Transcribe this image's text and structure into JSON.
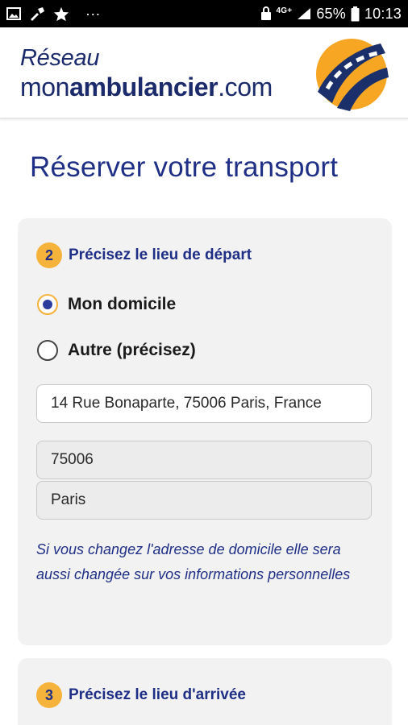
{
  "status_bar": {
    "left_icons": [
      "image-icon",
      "wrench-icon",
      "star-icon",
      "more-icon"
    ],
    "more_text": "···",
    "network": "4G+",
    "battery_percent": "65%",
    "time": "10:13"
  },
  "header": {
    "brand_line1": "Réseau",
    "brand_prefix": "mon",
    "brand_bold": "ambulancier",
    "brand_suffix": ".com",
    "logo_colors": {
      "blue": "#1b2f6b",
      "orange": "#f6a623"
    }
  },
  "page": {
    "title": "Réserver votre transport"
  },
  "departure": {
    "step_number": "2",
    "step_label": "Précisez le lieu de départ",
    "options": [
      {
        "label": "Mon domicile",
        "checked": true
      },
      {
        "label": "Autre (précisez)",
        "checked": false
      }
    ],
    "address_value": "14 Rue Bonaparte, 75006 Paris, France",
    "postal_code_value": "75006",
    "city_value": "Paris",
    "note": "Si vous changez l'adresse de domicile elle sera aussi changée sur vos informations personnelles"
  },
  "arrival": {
    "step_number": "3",
    "step_label": "Précisez le lieu d'arrivée"
  },
  "colors": {
    "primary": "#1f2f86",
    "accent": "#f6b33c",
    "card_bg": "#f2f2f2"
  }
}
